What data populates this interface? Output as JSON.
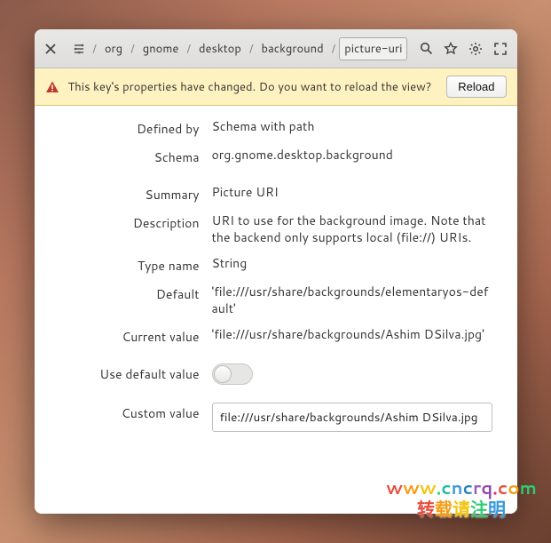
{
  "breadcrumb": {
    "seg0": "org",
    "seg1": "gnome",
    "seg2": "desktop",
    "seg3": "background",
    "seg4": "picture-uri"
  },
  "notice": {
    "text": "This key's properties have changed. Do you want to reload the view?",
    "reload_label": "Reload"
  },
  "fields": {
    "defined_by": {
      "label": "Defined by",
      "value": "Schema with path"
    },
    "schema": {
      "label": "Schema",
      "value": "org.gnome.desktop.background"
    },
    "summary": {
      "label": "Summary",
      "value": "Picture URI"
    },
    "description": {
      "label": "Description",
      "value": "URI to use for the background image. Note that the backend only supports local (file://) URIs."
    },
    "type_name": {
      "label": "Type name",
      "value": "String"
    },
    "default": {
      "label": "Default",
      "value": "'file:///usr/share/backgrounds/elementaryos-default'"
    },
    "current_value": {
      "label": "Current value",
      "value": "'file:///usr/share/backgrounds/Ashim DSilva.jpg'"
    },
    "use_default": {
      "label": "Use default value",
      "on": false
    },
    "custom_value": {
      "label": "Custom value",
      "value": "file:///usr/share/backgrounds/Ashim DSilva.jpg"
    }
  },
  "watermark": {
    "line1": "www.cncrq.com",
    "line2": "转载请注明"
  }
}
